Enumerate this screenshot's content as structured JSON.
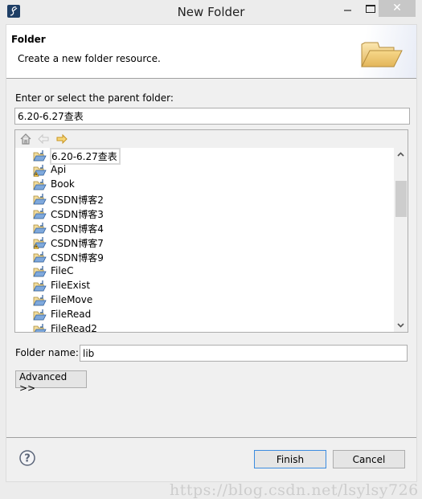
{
  "window": {
    "title": "New Folder",
    "minimize_label": "–",
    "maximize_label": "□",
    "close_label": "✕",
    "app_icon": "eclipse-pen-icon"
  },
  "header": {
    "title": "Folder",
    "description": "Create a new folder resource.",
    "icon": "open-folder-icon"
  },
  "parent": {
    "label": "Enter or select the parent folder:",
    "value": "6.20-6.27查表"
  },
  "tree": {
    "toolbar": {
      "home_icon": "home-icon",
      "back_icon": "back-arrow-icon",
      "forward_icon": "forward-arrow-icon"
    },
    "items": [
      {
        "label": "6.20-6.27查表",
        "selected": true,
        "warning": false
      },
      {
        "label": "Api",
        "selected": false,
        "warning": true
      },
      {
        "label": "Book",
        "selected": false,
        "warning": false
      },
      {
        "label": "CSDN博客2",
        "selected": false,
        "warning": false
      },
      {
        "label": "CSDN博客3",
        "selected": false,
        "warning": false
      },
      {
        "label": "CSDN博客4",
        "selected": false,
        "warning": false
      },
      {
        "label": "CSDN博客7",
        "selected": false,
        "warning": true
      },
      {
        "label": "CSDN博客9",
        "selected": false,
        "warning": false
      },
      {
        "label": "FileC",
        "selected": false,
        "warning": false
      },
      {
        "label": "FileExist",
        "selected": false,
        "warning": false
      },
      {
        "label": "FileMove",
        "selected": false,
        "warning": false
      },
      {
        "label": "FileRead",
        "selected": false,
        "warning": false
      },
      {
        "label": "FileRead2",
        "selected": false,
        "warning": false
      }
    ],
    "scroll_position": 0.12,
    "scroll_up_label": "⌃",
    "scroll_down_label": "⌄"
  },
  "folder_name": {
    "label": "Folder name:",
    "value": "lib"
  },
  "buttons": {
    "advanced": "Advanced >>",
    "finish": "Finish",
    "cancel": "Cancel"
  },
  "watermark": "https://blog.csdn.net/lsylsy726",
  "colors": {
    "folder_fill": "#e9c56f",
    "folder_blue": "#3b78c2",
    "default_button_border": "#3c8ce0",
    "forward_arrow": "#e8b93a"
  }
}
